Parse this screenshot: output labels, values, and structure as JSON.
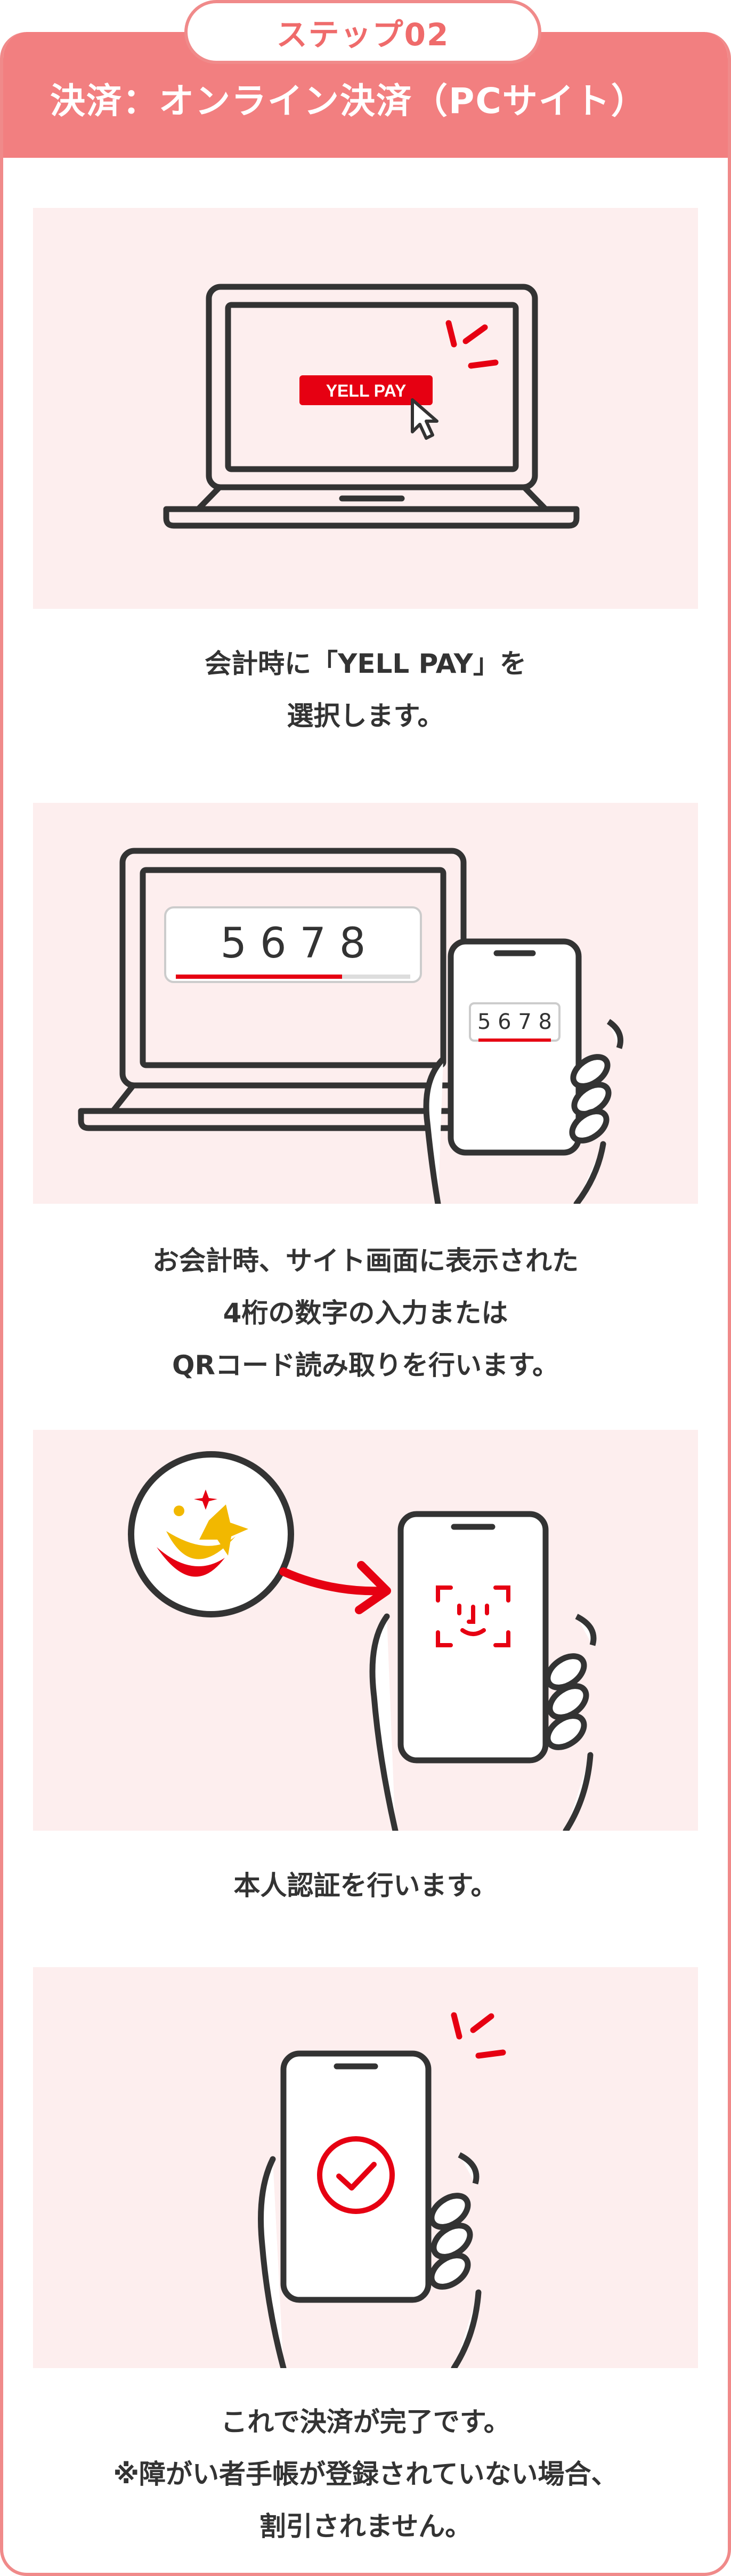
{
  "step": {
    "label": "ステップ02"
  },
  "header": {
    "title": "決済：オンライン決済（PCサイト）"
  },
  "colors": {
    "accent": "#e60012",
    "header_bg": "#f27f80",
    "panel_bg": "#fdeeee",
    "line": "#333333"
  },
  "steps": [
    {
      "screen_button": "YELL PAY",
      "caption_lines": [
        "会計時に「YELL PAY」を",
        "選択します。"
      ]
    },
    {
      "laptop_code": "5 6 7 8",
      "phone_code": "5 6 7 8",
      "caption_lines": [
        "お会計時、サイト画面に表示された",
        "4桁の数字の入力または",
        "QRコード読み取りを行います。"
      ]
    },
    {
      "icons": [
        "app-logo-icon",
        "arrow-right-icon",
        "face-id-icon"
      ],
      "caption_lines": [
        "本人認証を行います。"
      ]
    },
    {
      "icons": [
        "check-circle-icon"
      ],
      "caption_lines": [
        "これで決済が完了です。",
        "※障がい者手帳が登録されていない場合、",
        "割引されません。"
      ]
    }
  ]
}
